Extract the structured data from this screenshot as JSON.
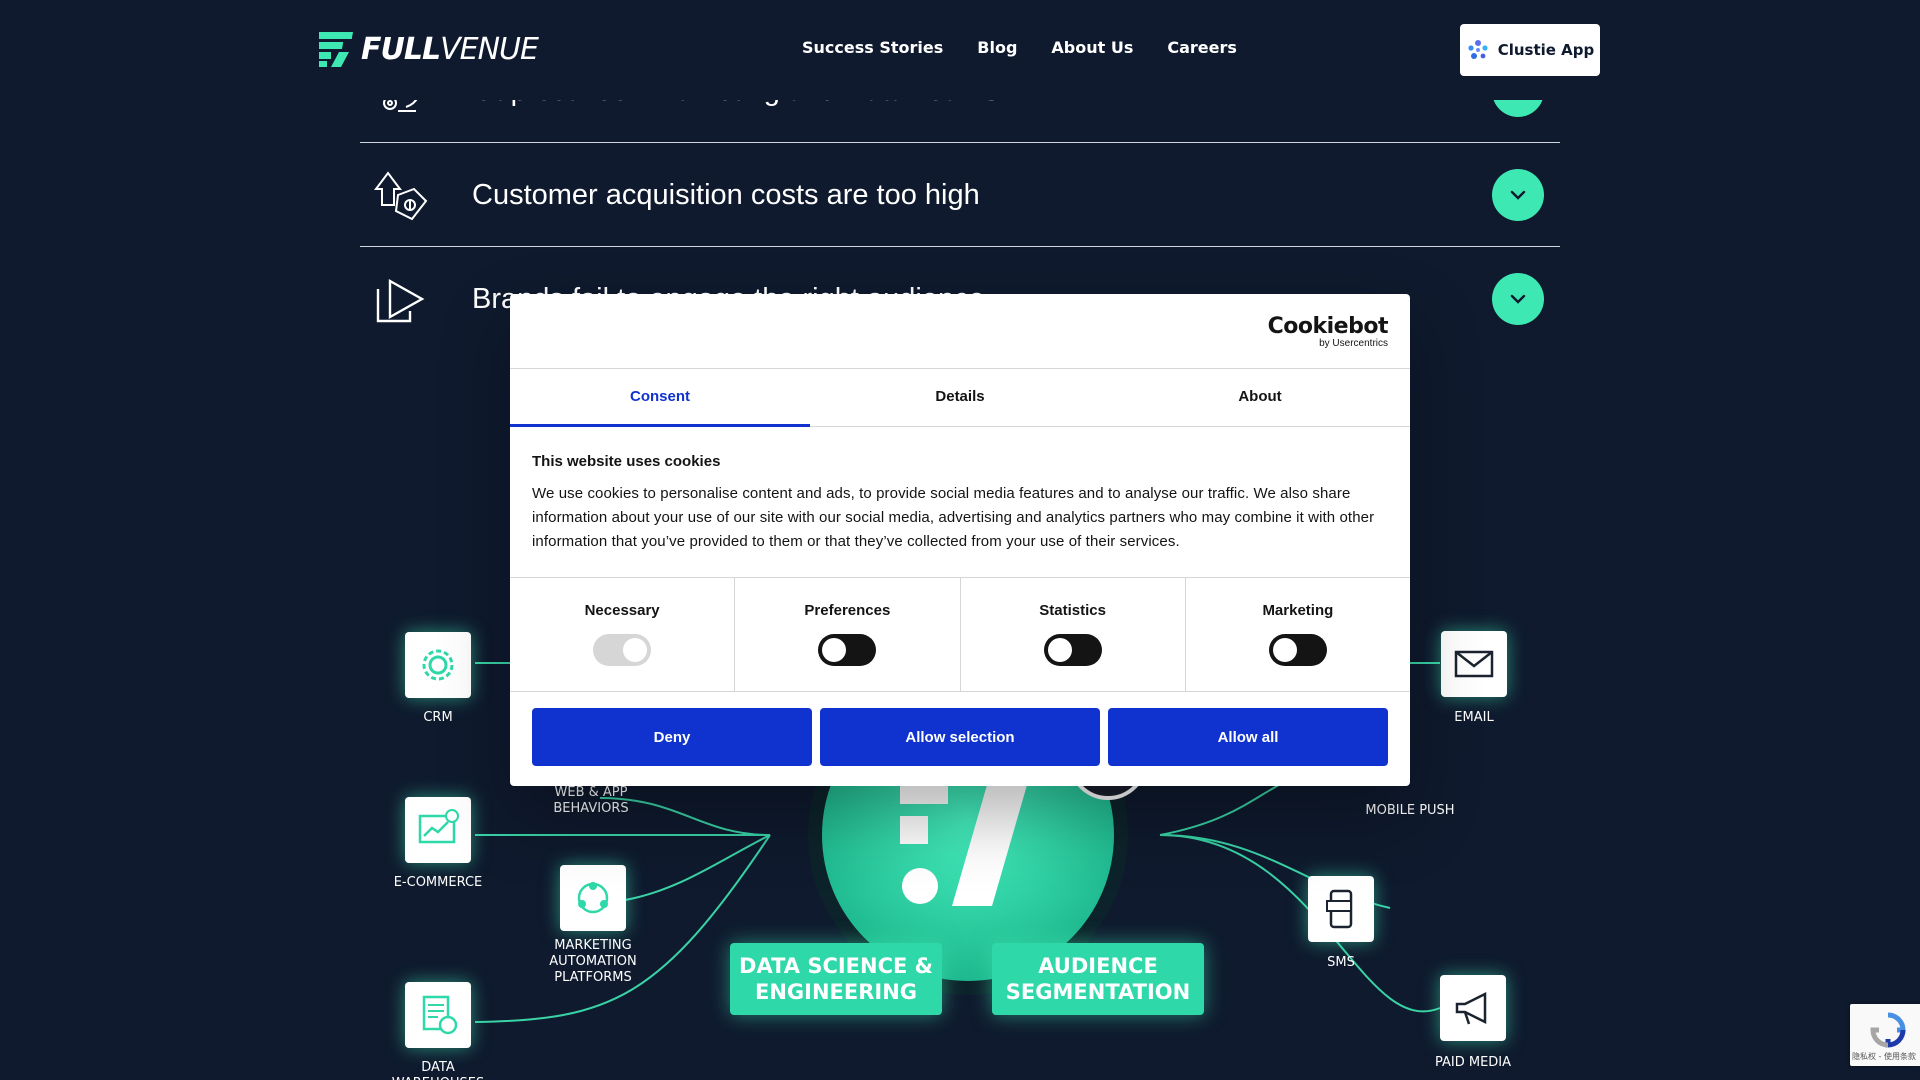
{
  "header": {
    "logo": {
      "part1": "FULL",
      "part2": "VENUE"
    },
    "nav": [
      "Success Stories",
      "Blog",
      "About Us",
      "Careers"
    ],
    "cta_label": "Clustie App"
  },
  "rows": [
    {
      "title": "Gap between Marketing and Data Teams",
      "icon": "team-gears-icon"
    },
    {
      "title": "Customer acquisition costs are too high",
      "icon": "price-tag-up-icon"
    },
    {
      "title": "Brands fail to engage the right audience",
      "icon": "play-arrow-icon"
    }
  ],
  "infographic": {
    "nodes": {
      "crm": "CRM",
      "ecommerce": "E-COMMERCE",
      "web_app": "WEB & APP\nBEHAVIORS",
      "map": "MARKETING\nAUTOMATION\nPLATFORMS",
      "dw": "DATA\nWAREHOUSES",
      "email": "EMAIL",
      "push": "MOBILE PUSH",
      "sms": "SMS",
      "paid": "PAID MEDIA"
    },
    "pills": {
      "left": "DATA SCIENCE &\nENGINEERING",
      "right": "AUDIENCE\nSEGMENTATION"
    }
  },
  "cookie_dialog": {
    "brand": "Cookiebot",
    "brand_sub": "by Usercentrics",
    "tabs": [
      "Consent",
      "Details",
      "About"
    ],
    "active_tab": "Consent",
    "heading": "This website uses cookies",
    "body": "We use cookies to personalise content and ads, to provide social media features and to analyse our traffic. We also share information about your use of our site with our social media, advertising and analytics partners who may combine it with other information that you’ve provided to them or that they’ve collected from your use of their services.",
    "toggles": [
      {
        "label": "Necessary",
        "on": true,
        "disabled": true
      },
      {
        "label": "Preferences",
        "on": false,
        "disabled": false
      },
      {
        "label": "Statistics",
        "on": false,
        "disabled": false
      },
      {
        "label": "Marketing",
        "on": false,
        "disabled": false
      }
    ],
    "buttons": {
      "deny": "Deny",
      "selection": "Allow selection",
      "all": "Allow all"
    }
  },
  "recaptcha": {
    "text": "隐私权 - 使用条款"
  },
  "colors": {
    "background": "#0f1a2e",
    "accent": "#3ee8b3",
    "dialog_primary": "#1032cf"
  }
}
